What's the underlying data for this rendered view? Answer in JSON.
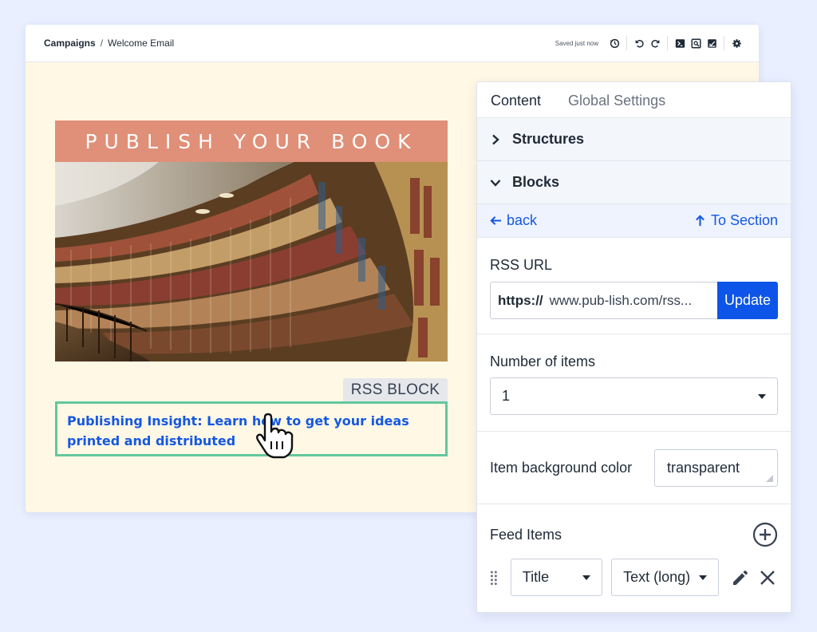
{
  "topbar": {
    "breadcrumb_root": "Campaigns",
    "breadcrumb_sep": "/",
    "breadcrumb_current": "Welcome Email",
    "saved_status": "Saved just now",
    "icons": [
      "history-icon",
      "undo-icon",
      "redo-icon",
      "code-icon",
      "preview-icon",
      "test-send-icon",
      "settings-gear-icon"
    ]
  },
  "email": {
    "header_text": "PUBLISH YOUR BOOK",
    "header_color": "#e08f78",
    "hero_image": "library-bookshelves-photo",
    "rss_tag": "RSS BLOCK",
    "rss_link_text": "Publishing Insight: Learn how to get your ideas printed and distributed",
    "selected_outline_color": "#63c79d"
  },
  "panel": {
    "tabs": [
      {
        "label": "Content",
        "active": true
      },
      {
        "label": "Global Settings",
        "active": false
      }
    ],
    "structures_label": "Structures",
    "blocks_label": "Blocks",
    "back_label": "back",
    "to_section_label": "To Section",
    "rss_url": {
      "label": "RSS URL",
      "protocol": "https://",
      "value": "www.pub-lish.com/rss...",
      "button": "Update"
    },
    "num_items": {
      "label": "Number of items",
      "value": "1"
    },
    "bg_color": {
      "label": "Item background color",
      "value": "transparent"
    },
    "feed_items": {
      "label": "Feed Items",
      "field_select": "Title",
      "format_select": "Text (long)"
    },
    "accent_color": "#0d55e8"
  }
}
